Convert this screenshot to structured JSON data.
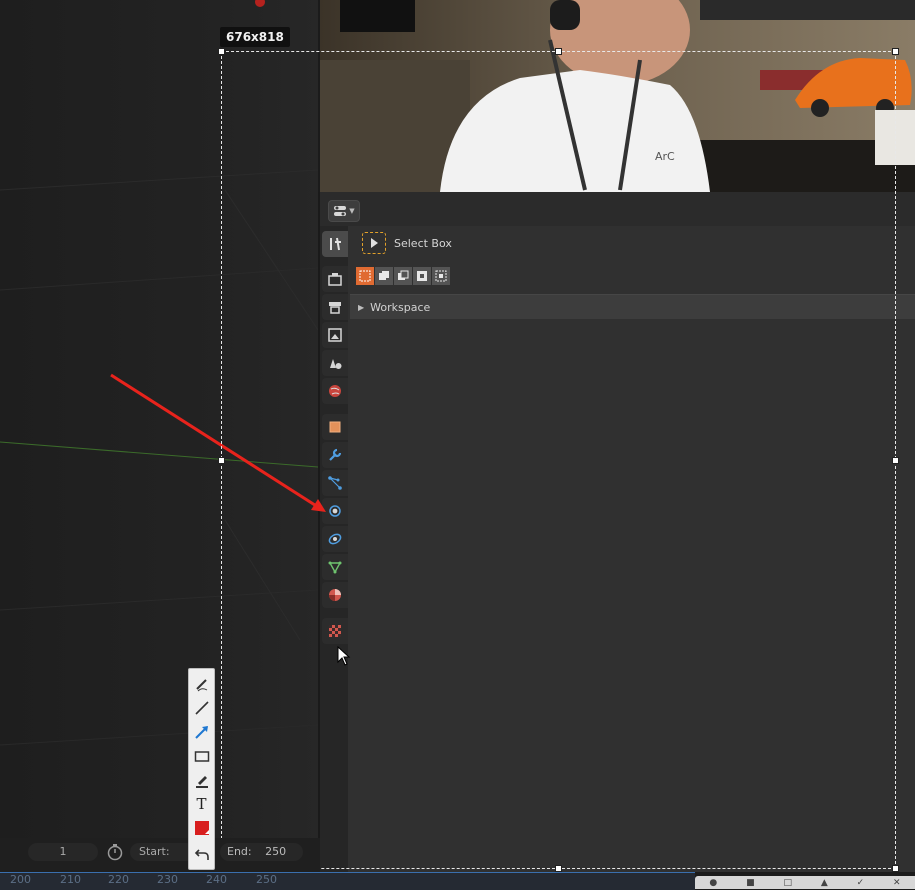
{
  "snip": {
    "size_label": "676x818"
  },
  "webcam": {
    "shirt_text": "ArC"
  },
  "properties": {
    "active_tool": {
      "name": "Select Box",
      "icon": "select-box-icon"
    },
    "mode_buttons": [
      {
        "name": "mode-new-set-icon",
        "active": true
      },
      {
        "name": "mode-extend-icon",
        "active": false
      },
      {
        "name": "mode-subtract-icon",
        "active": false
      },
      {
        "name": "mode-difference-icon",
        "active": false
      },
      {
        "name": "mode-intersect-icon",
        "active": false
      }
    ],
    "workspace_panel": {
      "label": "Workspace"
    },
    "tabs": [
      {
        "name": "tab-tool",
        "icon": "tool-icon",
        "active": true
      },
      {
        "name": "tab-render",
        "icon": "render-icon"
      },
      {
        "name": "tab-output",
        "icon": "output-icon"
      },
      {
        "name": "tab-view-layer",
        "icon": "view-layer-icon"
      },
      {
        "name": "tab-scene",
        "icon": "scene-icon"
      },
      {
        "name": "tab-world",
        "icon": "world-icon"
      },
      {
        "name": "tab-object",
        "icon": "object-icon"
      },
      {
        "name": "tab-modifiers",
        "icon": "wrench-icon"
      },
      {
        "name": "tab-particles",
        "icon": "particles-icon"
      },
      {
        "name": "tab-physics",
        "icon": "physics-icon"
      },
      {
        "name": "tab-constraints",
        "icon": "constraints-icon"
      },
      {
        "name": "tab-data",
        "icon": "mesh-data-icon"
      },
      {
        "name": "tab-material",
        "icon": "material-icon"
      },
      {
        "name": "tab-texture",
        "icon": "texture-icon"
      }
    ]
  },
  "timeline": {
    "current_frame": "1",
    "start_label": "Start:",
    "end_label": "End:",
    "end_value": "250"
  },
  "frame_ruler": [
    "200",
    "210",
    "220",
    "230",
    "240",
    "250"
  ],
  "annotation_tools": [
    "freehand-icon",
    "line-icon",
    "arrow-icon",
    "rectangle-icon",
    "highlighter-icon",
    "text-icon",
    "color-swatch-icon",
    "undo-icon"
  ],
  "colors": {
    "arrow": "#e8231c",
    "active_mode": "#e06b32",
    "active_tool_border": "#e2a12a"
  }
}
